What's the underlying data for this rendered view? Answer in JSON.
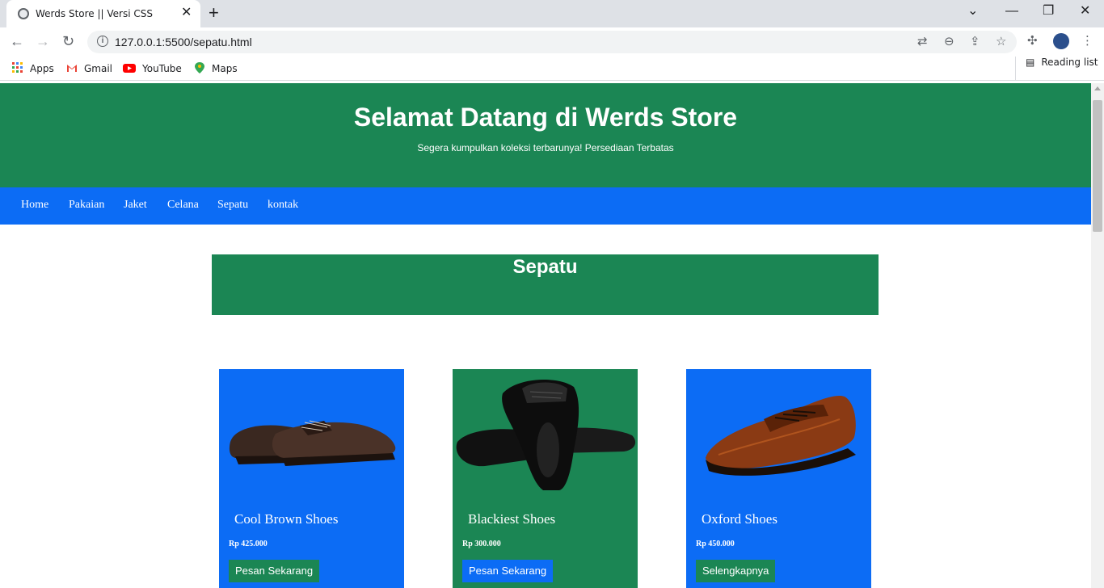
{
  "browser": {
    "tab_title": "Werds Store || Versi CSS",
    "url": "127.0.0.1:5500/sepatu.html",
    "bookmarks": [
      "Apps",
      "Gmail",
      "YouTube",
      "Maps"
    ],
    "reading_list": "Reading list"
  },
  "header": {
    "title": "Selamat Datang di Werds Store",
    "subtitle": "Segera kumpulkan koleksi terbarunya! Persediaan Terbatas"
  },
  "nav": [
    "Home",
    "Pakaian",
    "Jaket",
    "Celana",
    "Sepatu",
    "kontak"
  ],
  "section": {
    "title": "Sepatu"
  },
  "products": [
    {
      "name": "Cool Brown Shoes",
      "price": "Rp 425.000",
      "button": "Pesan Sekarang"
    },
    {
      "name": "Blackiest Shoes",
      "price": "Rp 300.000",
      "button": "Pesan Sekarang"
    },
    {
      "name": "Oxford Shoes",
      "price": "Rp 450.000",
      "button": "Selengkapnya"
    }
  ],
  "colors": {
    "green": "#1b8654",
    "blue": "#0c6cf5"
  }
}
